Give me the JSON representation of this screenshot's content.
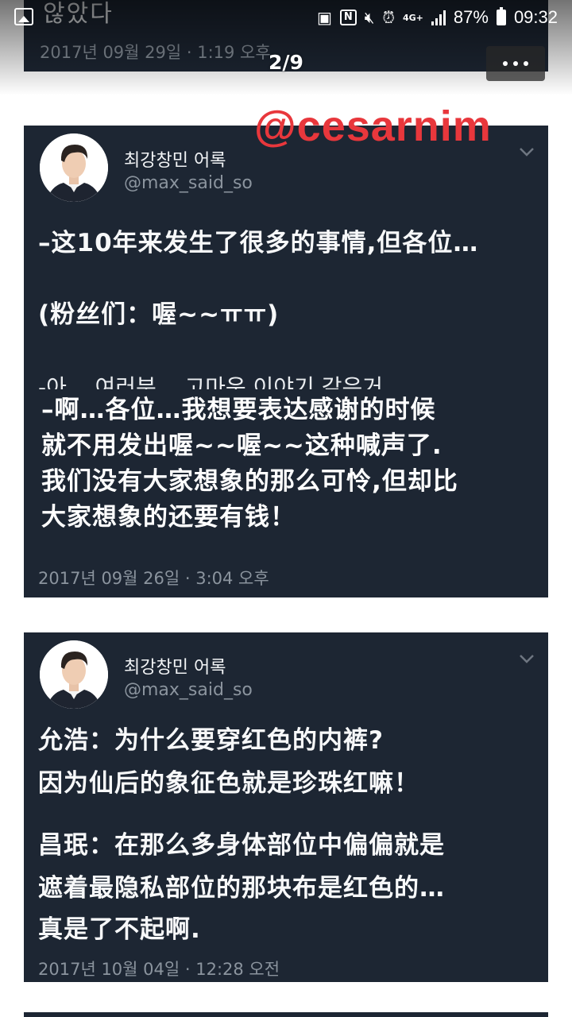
{
  "status_bar": {
    "network_label": "4G+",
    "battery_percent": "87%",
    "clock": "09:32",
    "icons": [
      "gallery-icon",
      "screenshot-icon",
      "nfc-icon",
      "mute-icon",
      "alarm-icon",
      "signal-icon",
      "battery-icon"
    ]
  },
  "viewer": {
    "page_indicator": "2/9",
    "more_icon": "more-dots-icon"
  },
  "watermark": "@cesarnim",
  "top_card": {
    "partial_text": "않았다",
    "timestamp": "2017년 09월 29일 · 1:19 오후"
  },
  "tweets": [
    {
      "display_name": "최강창민 어록",
      "handle": "@max_said_so",
      "lines": [
        "–这10年来发生了很多的事情,但各位…",
        "(粉丝们：喔~~ㅠㅠ)"
      ],
      "korean_line": "-아... 여러분... 고마운 이야기 같은거",
      "caption_lines": [
        "–啊…各位…我想要表达感谢的时候",
        "就不用发出喔~~喔~~这种喊声了.",
        "我们没有大家想象的那么可怜,但却比",
        "大家想象的还要有钱！"
      ],
      "timestamp": "2017년 09월 26일 · 3:04 오후"
    },
    {
      "display_name": "최강창민 어록",
      "handle": "@max_said_so",
      "lines": [
        "允浩：为什么要穿红色的内裤?",
        "因为仙后的象征色就是珍珠红嘛！",
        "昌珉：在那么多身体部位中偏偏就是",
        "遮着最隐私部位的那块布是红色的…",
        "真是了不起啊."
      ],
      "timestamp": "2017년 10월 04일 · 12:28 오전"
    }
  ],
  "colors": {
    "card_bg": "#1d2633",
    "muted_text": "#8b949e",
    "watermark": "#e8373c"
  }
}
